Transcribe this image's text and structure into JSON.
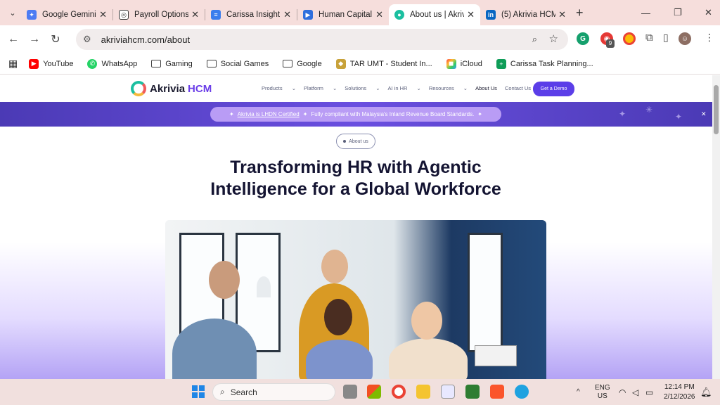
{
  "tabs": [
    {
      "title": "Google Gemini",
      "active": false
    },
    {
      "title": "Payroll Options",
      "active": false
    },
    {
      "title": "Carissa Insight B",
      "active": false
    },
    {
      "title": "Human Capital N",
      "active": false
    },
    {
      "title": "About us | Akriv",
      "active": true
    },
    {
      "title": "(5) Akrivia HCM",
      "active": false
    }
  ],
  "toolbar": {
    "url": "akriviahcm.com/about",
    "ext_badge": "9"
  },
  "bookmarks": [
    "YouTube",
    "WhatsApp",
    "Gaming",
    "Social Games",
    "Google",
    "TAR UMT - Student In...",
    "iCloud",
    "Carissa Task Planning..."
  ],
  "site": {
    "brand": "Akrivia",
    "brand_suffix": "HCM",
    "nav": [
      "Products",
      "Platform",
      "Solutions",
      "AI in HR",
      "Resources",
      "About Us",
      "Contact Us"
    ],
    "cta": "Get a Demo",
    "banner_link": "Akrivia is LHDN Certified",
    "banner_text": "Fully compliant with Malaysia's Inland Revenue Board Standards.",
    "badge": "About us",
    "headline_line1": "Transforming HR with Agentic",
    "headline_line2": "Intelligence for a Global Workforce"
  },
  "taskbar": {
    "search": "Search",
    "lang1": "ENG",
    "lang2": "US",
    "time": "12:14 PM",
    "date": "2/12/2026"
  }
}
